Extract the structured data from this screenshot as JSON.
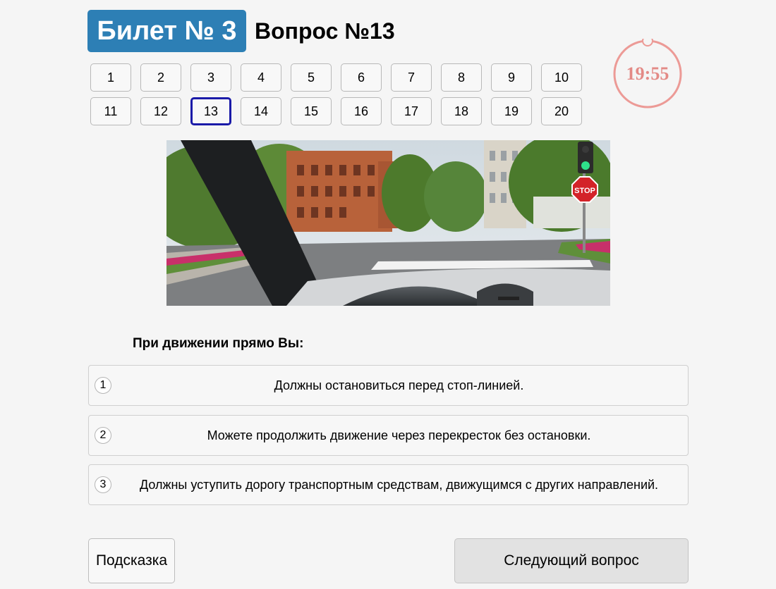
{
  "header": {
    "ticket_label": "Билет № 3",
    "question_label": "Вопрос №13"
  },
  "question_nav": {
    "active": 13,
    "items": [
      "1",
      "2",
      "3",
      "4",
      "5",
      "6",
      "7",
      "8",
      "9",
      "10",
      "11",
      "12",
      "13",
      "14",
      "15",
      "16",
      "17",
      "18",
      "19",
      "20"
    ]
  },
  "timer": {
    "time": "19:55",
    "color": "#e38a86"
  },
  "scene": {
    "sign_text": "STOP",
    "description_icons": [
      "stop-sign",
      "traffic-light-green"
    ]
  },
  "question": {
    "prompt": "При движении прямо Вы:",
    "answers": [
      {
        "num": "1",
        "text": "Должны остановиться перед стоп-линией."
      },
      {
        "num": "2",
        "text": "Можете продолжить движение через перекресток без остановки."
      },
      {
        "num": "3",
        "text": "Должны уступить дорогу транспортным средствам, движущимся с других направлений."
      }
    ]
  },
  "footer": {
    "hint_label": "Подсказка",
    "next_label": "Следующий вопрос"
  },
  "colors": {
    "ticket_badge": "#2d7fb5",
    "active_question_border": "#1a1aa8"
  }
}
